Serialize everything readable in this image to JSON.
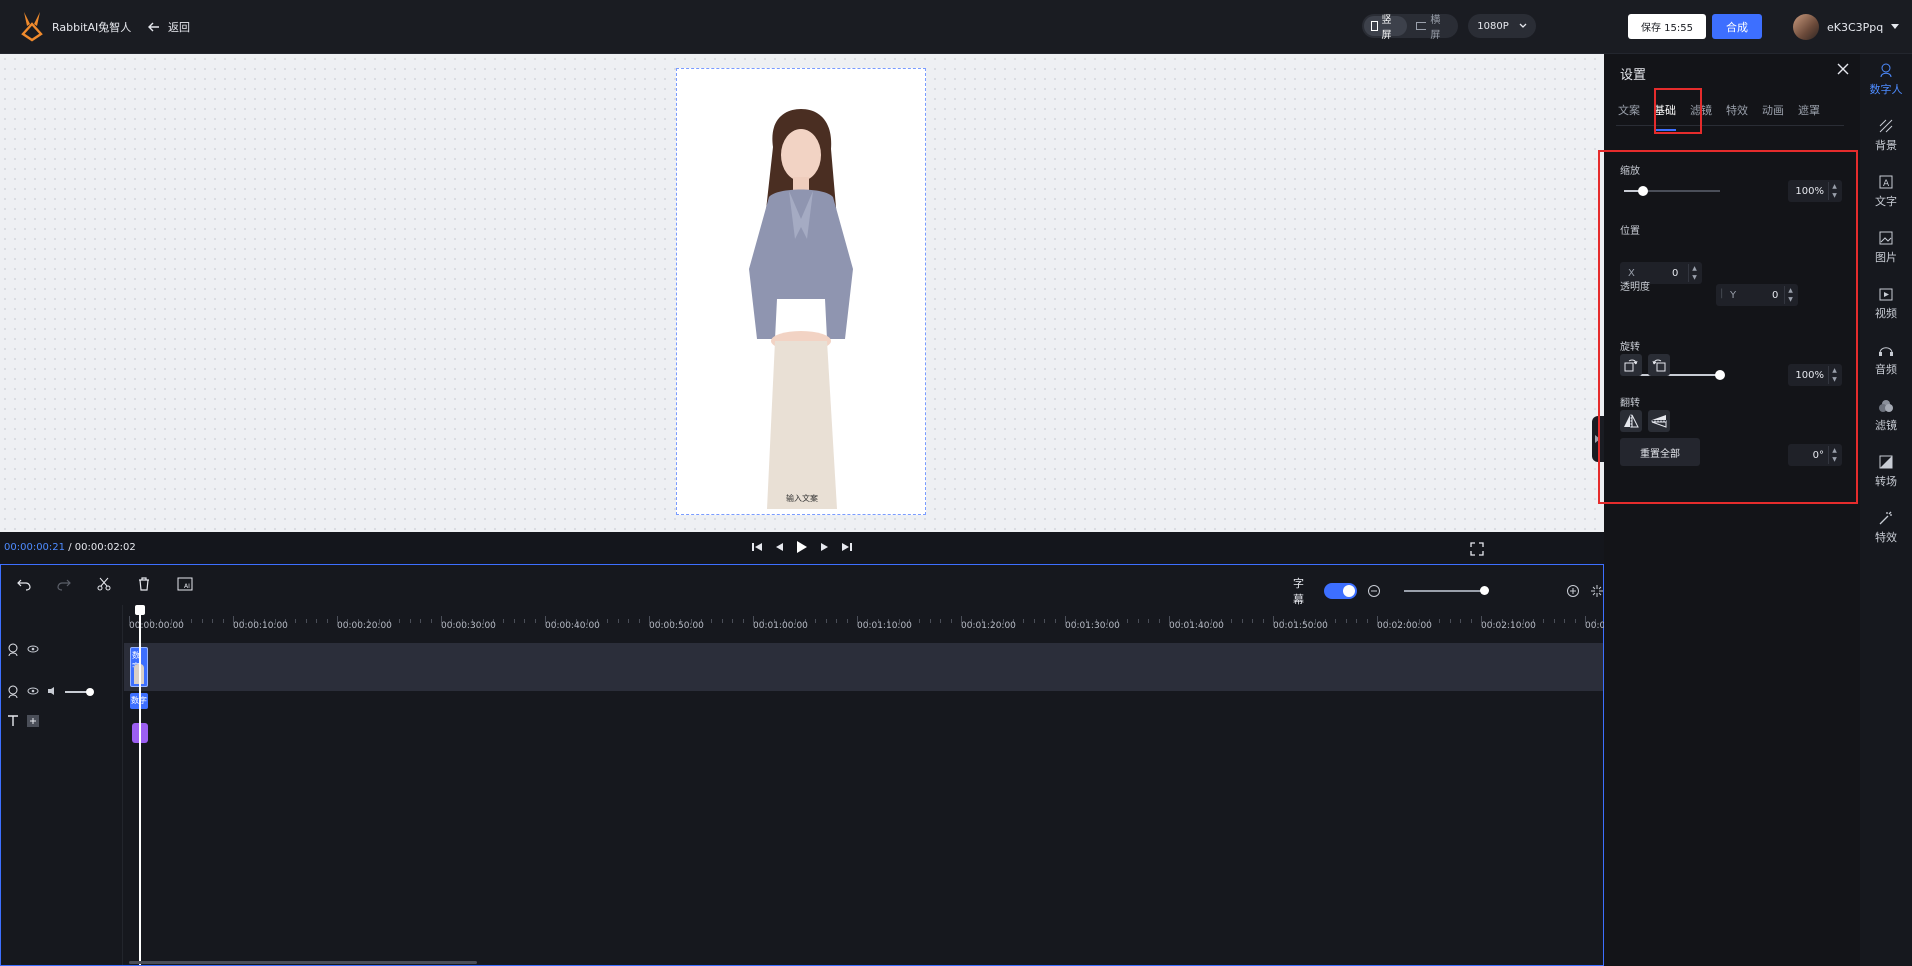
{
  "app": {
    "brand": "RabbitAI兔智人",
    "back_label": "返回"
  },
  "header": {
    "orientation": [
      {
        "label": "竖屏",
        "active": true
      },
      {
        "label": "横屏",
        "active": false
      }
    ],
    "resolution": "1080P",
    "save_label": "保存 15:55",
    "compose_label": "合成",
    "username": "eK3C3Ppq"
  },
  "canvas": {
    "caption": "输入文案"
  },
  "playbar": {
    "current_time": "00:00:00:21",
    "separator": "/",
    "total_time": "00:00:02:02"
  },
  "timeline": {
    "subtitle_label": "字幕",
    "subtitle_enabled": true,
    "ruler": [
      "00:00:00:00",
      "00:00:10:00",
      "00:00:20:00",
      "00:00:30:00",
      "00:00:40:00",
      "00:00:50:00",
      "00:01:00:00",
      "00:01:10:00",
      "00:01:20:00",
      "00:01:30:00",
      "00:01:40:00",
      "00:01:50:00",
      "00:02:00:00",
      "00:02:10:00",
      "00:0"
    ],
    "clip_label": "数字"
  },
  "settings": {
    "title": "设置",
    "tabs": [
      "文案",
      "基础",
      "滤镜",
      "特效",
      "动画",
      "遮罩"
    ],
    "active_tab": "基础",
    "scale": {
      "label": "缩放",
      "value": "100%",
      "level": 0.2
    },
    "position": {
      "label": "位置",
      "x_label": "X",
      "x_value": "0",
      "y_label": "Y",
      "y_value": "0"
    },
    "opacity": {
      "label": "透明度",
      "value": "100%",
      "level": 1.0
    },
    "rotate": {
      "label": "旋转",
      "value": "0°"
    },
    "flip": {
      "label": "翻转"
    },
    "reset_label": "重置全部"
  },
  "rightnav": [
    {
      "label": "数字人",
      "icon": "digital-human-icon",
      "active": true
    },
    {
      "label": "背景",
      "icon": "background-icon",
      "active": false
    },
    {
      "label": "文字",
      "icon": "text-icon",
      "active": false
    },
    {
      "label": "图片",
      "icon": "image-icon",
      "active": false
    },
    {
      "label": "视频",
      "icon": "video-icon",
      "active": false
    },
    {
      "label": "音频",
      "icon": "audio-icon",
      "active": false
    },
    {
      "label": "滤镜",
      "icon": "filter-icon",
      "active": false
    },
    {
      "label": "转场",
      "icon": "transition-icon",
      "active": false
    },
    {
      "label": "特效",
      "icon": "effects-icon",
      "active": false
    }
  ],
  "colors": {
    "accent": "#3d6fff",
    "highlight": "#e52c2c",
    "panel": "#131418"
  }
}
